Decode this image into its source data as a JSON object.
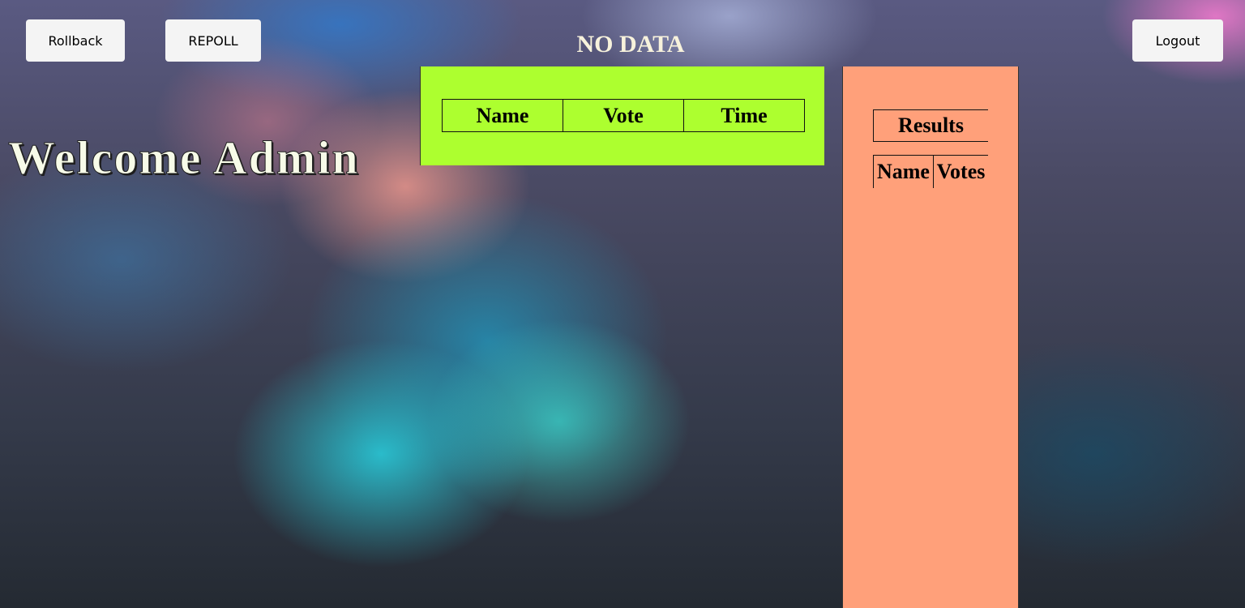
{
  "toolbar": {
    "rollback_label": "Rollback",
    "repoll_label": "REPOLL",
    "logout_label": "Logout"
  },
  "status_text": "NO DATA",
  "welcome_text": "Welcome Admin",
  "votes_table": {
    "columns": [
      "Name",
      "Vote",
      "Time"
    ],
    "rows": []
  },
  "results": {
    "title": "Results",
    "columns": [
      "Name",
      "Votes"
    ],
    "rows": []
  },
  "colors": {
    "votes_panel_bg": "#adff2f",
    "results_panel_bg": "#ffa07a",
    "button_bg": "#f4f4f4",
    "welcome_text": "#f7fbe8"
  }
}
